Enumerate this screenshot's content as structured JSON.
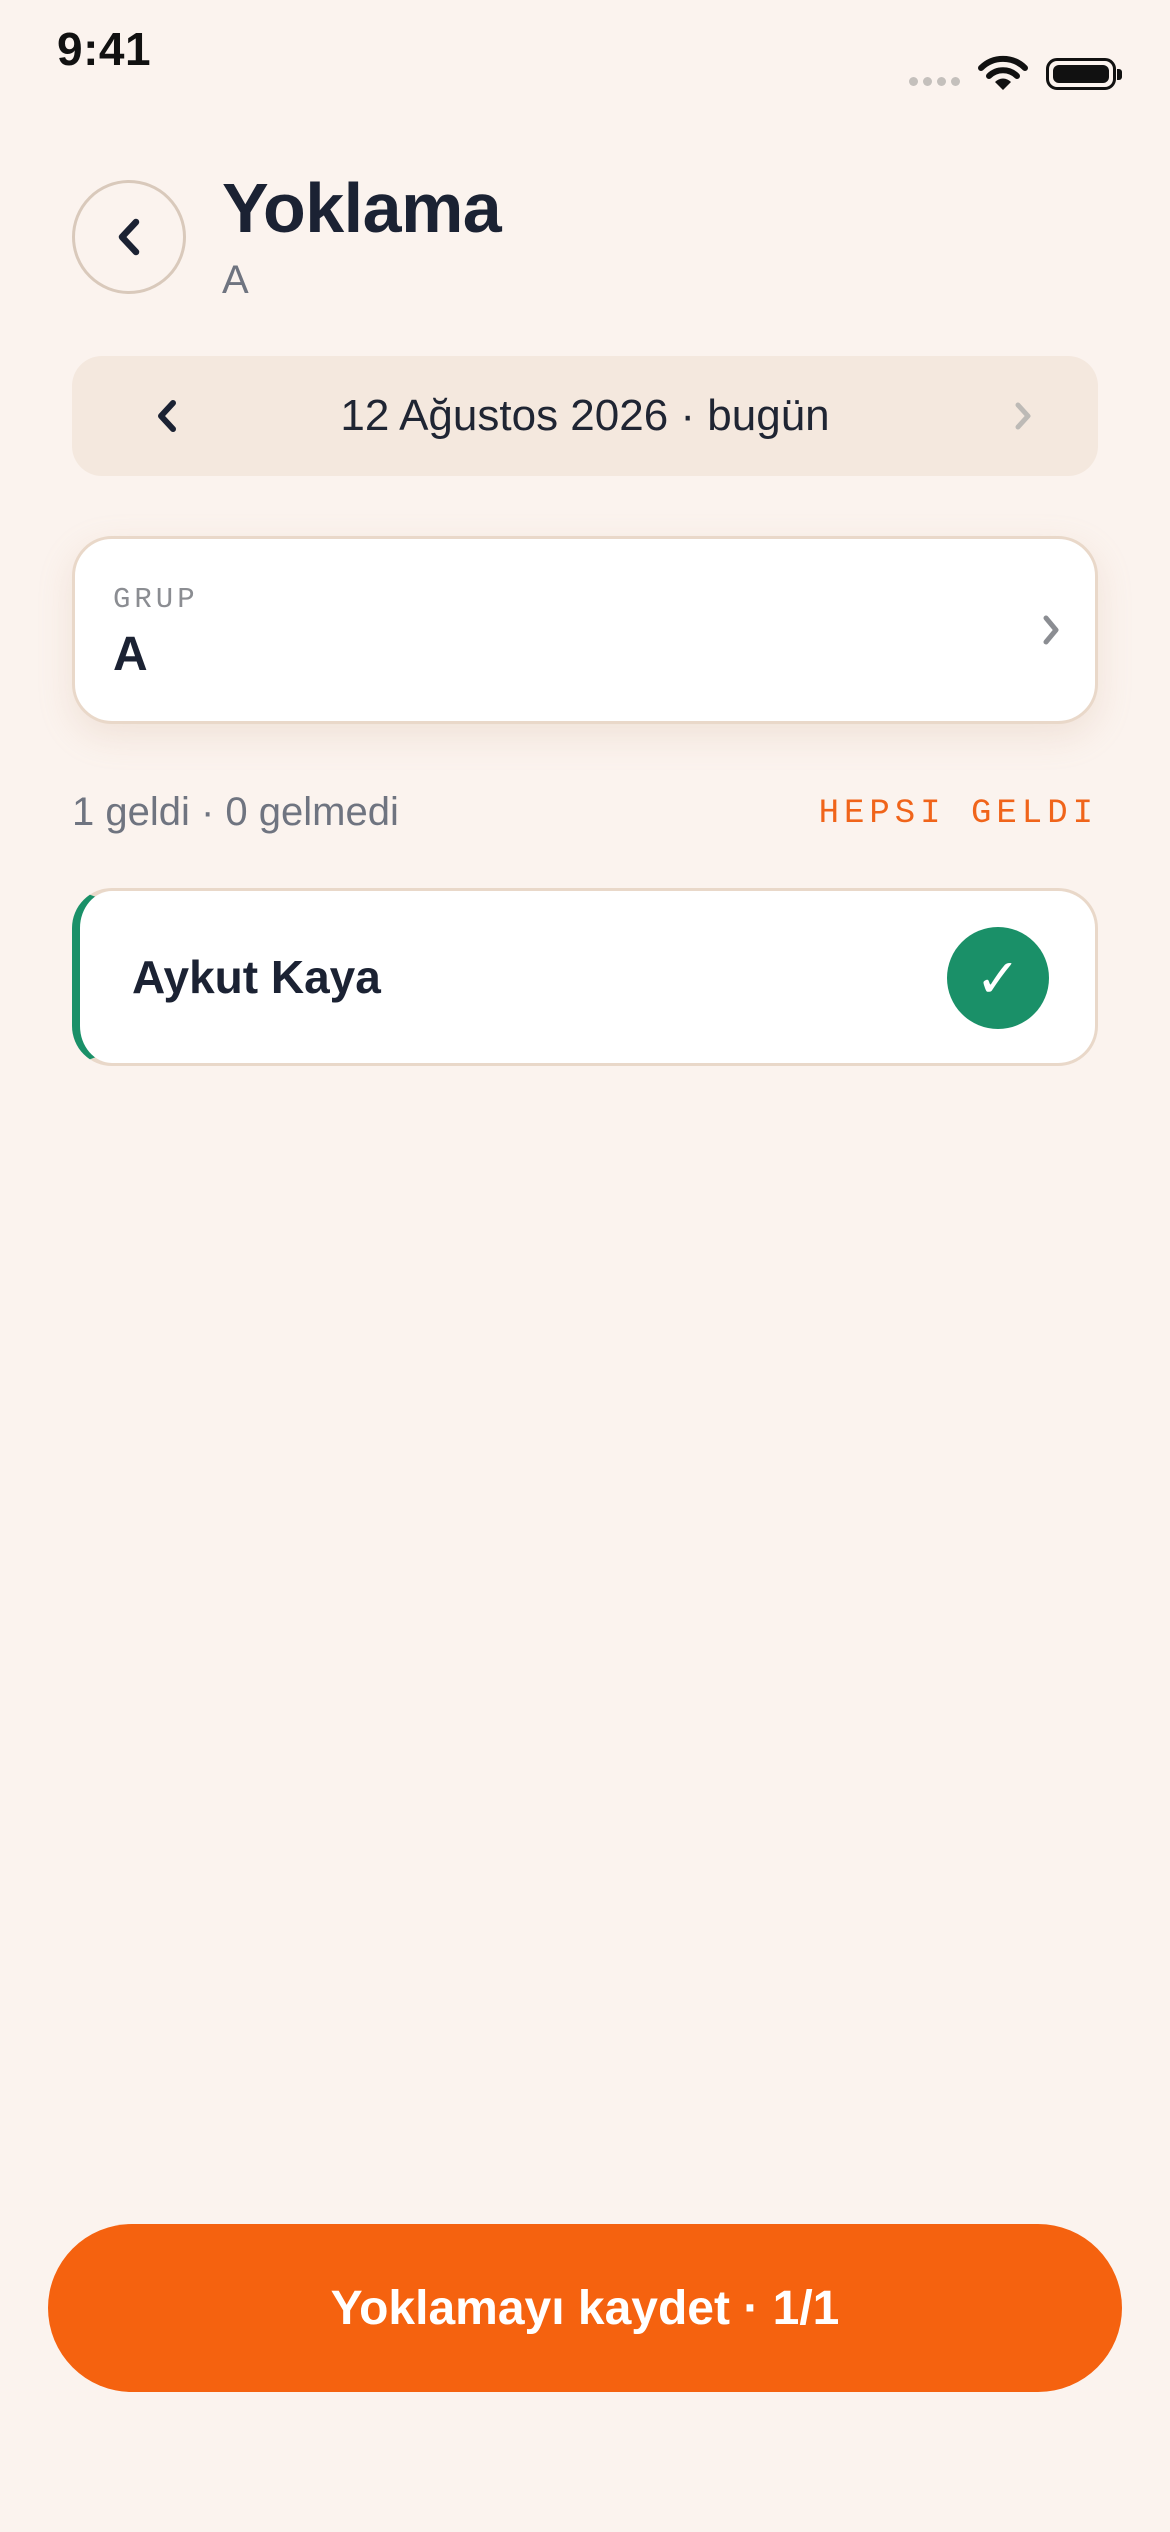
{
  "status_bar": {
    "time": "9:41"
  },
  "header": {
    "back_icon": "chevron-left-icon",
    "title": "Yoklama",
    "subtitle": "A"
  },
  "date_nav": {
    "prev_icon": "chevron-left-icon",
    "label": "12 Ağustos 2026 · bugün",
    "next_icon": "chevron-right-icon"
  },
  "group": {
    "caption": "GRUP",
    "value": "A"
  },
  "summary": {
    "counts": "1 geldi · 0 gelmedi",
    "mark_all_label": "HEPSI GELDI"
  },
  "students": [
    {
      "name": "Aykut Kaya",
      "status": "present",
      "status_icon": "✓"
    }
  ],
  "save_button": {
    "label": "Yoklamayı kaydet · 1/1"
  },
  "colors": {
    "background": "#fbf3ee",
    "accent": "#f5620f",
    "present": "#1a9068",
    "text": "#1b2233"
  }
}
